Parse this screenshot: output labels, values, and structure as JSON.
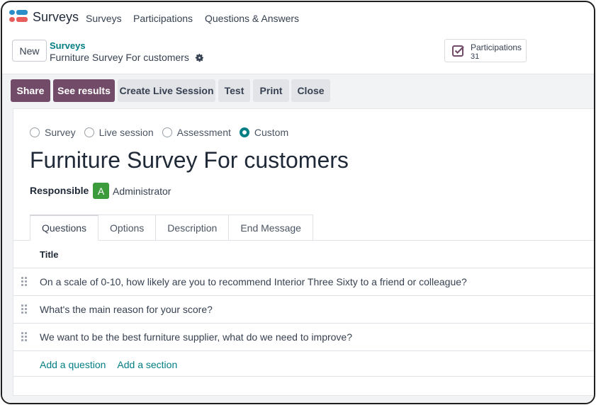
{
  "topnav": {
    "app_title": "Surveys",
    "menu": [
      "Surveys",
      "Participations",
      "Questions & Answers"
    ]
  },
  "control_panel": {
    "new_label": "New",
    "breadcrumb_parent": "Surveys",
    "breadcrumb_current": "Furniture Survey For customers",
    "stat_button": {
      "label": "Participations",
      "count": "31"
    }
  },
  "actions": {
    "share": "Share",
    "see_results": "See results",
    "create_live_session": "Create Live Session",
    "test": "Test",
    "print": "Print",
    "close": "Close"
  },
  "form": {
    "survey_types": [
      {
        "label": "Survey",
        "checked": false
      },
      {
        "label": "Live session",
        "checked": false
      },
      {
        "label": "Assessment",
        "checked": false
      },
      {
        "label": "Custom",
        "checked": true
      }
    ],
    "title": "Furniture Survey For customers",
    "responsible_label": "Responsible",
    "responsible_initial": "A",
    "responsible_name": "Administrator",
    "tabs": [
      "Questions",
      "Options",
      "Description",
      "End Message"
    ],
    "active_tab": "Questions",
    "list_header": "Title",
    "questions": [
      "On a scale of 0-10, how likely are you to recommend Interior Three Sixty to a friend or colleague?",
      "What's the main reason for your score?",
      "We want to be the best furniture supplier, what do we need to improve?"
    ],
    "add_question": "Add a question",
    "add_section": "Add a section"
  },
  "colors": {
    "primary": "#714b67",
    "accent": "#017e84",
    "avatar": "#3c9c3c"
  }
}
